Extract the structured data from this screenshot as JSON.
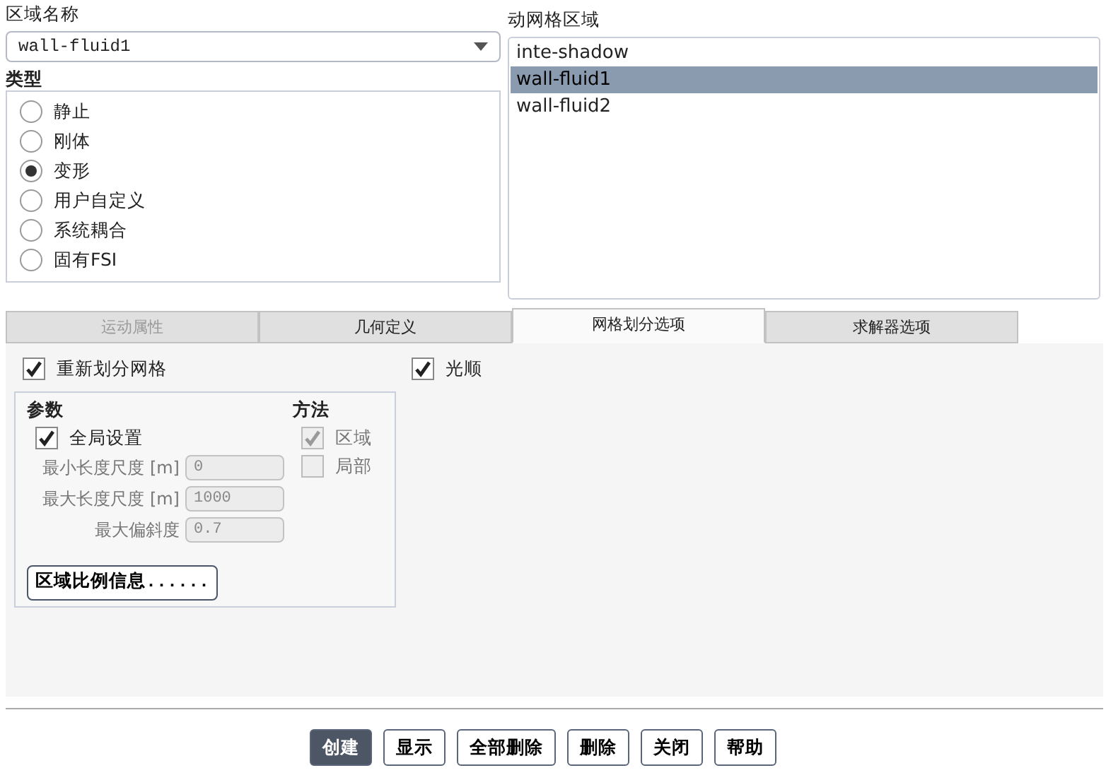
{
  "zone_name": {
    "label": "区域名称",
    "value": "wall-fluid1"
  },
  "type": {
    "label": "类型",
    "options": [
      {
        "label": "静止",
        "selected": false
      },
      {
        "label": "刚体",
        "selected": false
      },
      {
        "label": "变形",
        "selected": true
      },
      {
        "label": "用户自定义",
        "selected": false
      },
      {
        "label": "系统耦合",
        "selected": false
      },
      {
        "label": "固有FSI",
        "selected": false
      }
    ]
  },
  "dynamic_zones": {
    "label": "动网格区域",
    "items": [
      {
        "label": "inte-shadow",
        "selected": false
      },
      {
        "label": "wall-fluid1",
        "selected": true
      },
      {
        "label": "wall-fluid2",
        "selected": false
      }
    ]
  },
  "tabs": [
    {
      "label": "运动属性",
      "selected": false,
      "disabled": true
    },
    {
      "label": "几何定义",
      "selected": false,
      "disabled": false
    },
    {
      "label": "网格划分选项",
      "selected": true,
      "disabled": false
    },
    {
      "label": "求解器选项",
      "selected": false,
      "disabled": false
    }
  ],
  "options": [
    {
      "label": "重新划分网格",
      "checked": true
    },
    {
      "label": "光顺",
      "checked": true
    }
  ],
  "parameters": {
    "label": "参数",
    "global": {
      "label": "全局设置",
      "checked": true
    },
    "fields": [
      {
        "label": "最小长度尺度 [m]",
        "value": "0"
      },
      {
        "label": "最大长度尺度 [m]",
        "value": "1000"
      },
      {
        "label": "最大偏斜度",
        "value": "0.7"
      }
    ],
    "button": "区域比例信息......"
  },
  "method": {
    "label": "方法",
    "options": [
      {
        "label": "区域",
        "checked": true,
        "disabled": true
      },
      {
        "label": "局部",
        "checked": false,
        "disabled": true
      }
    ]
  },
  "buttons": [
    {
      "label": "创建",
      "default": true
    },
    {
      "label": "显示",
      "default": false
    },
    {
      "label": "全部删除",
      "default": false
    },
    {
      "label": "删除",
      "default": false
    },
    {
      "label": "关闭",
      "default": false
    },
    {
      "label": "帮助",
      "default": false
    }
  ]
}
